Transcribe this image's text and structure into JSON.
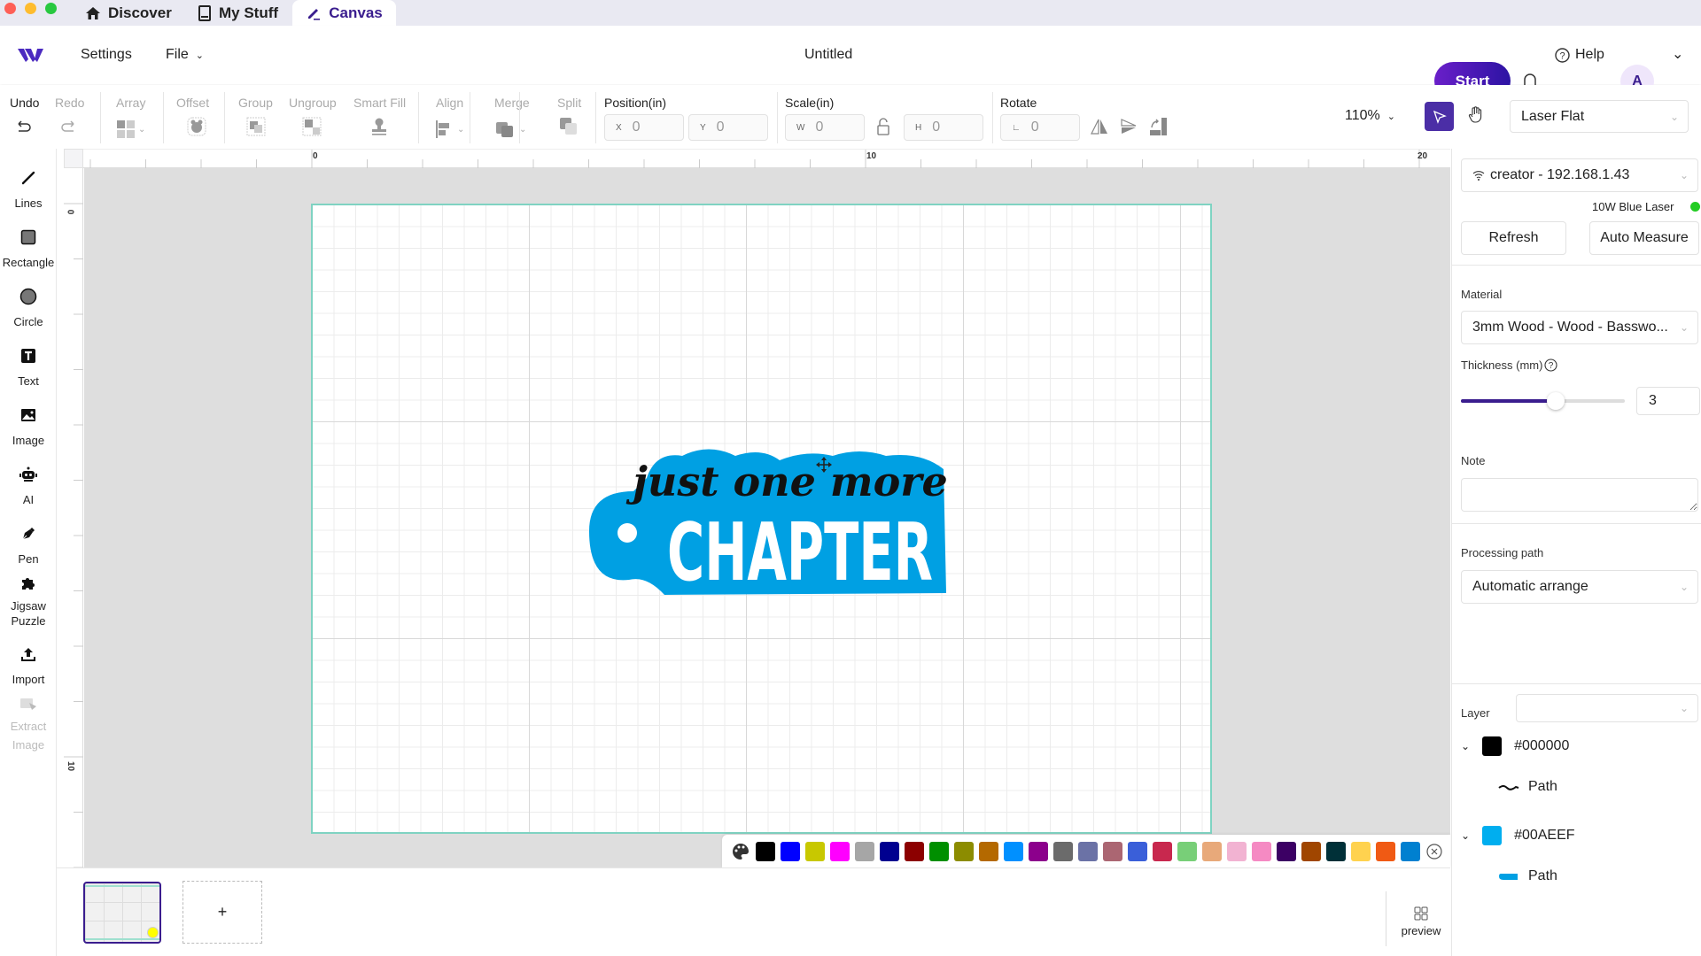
{
  "tabs": [
    {
      "label": "Discover",
      "icon": "home-icon"
    },
    {
      "label": "My Stuff",
      "icon": "tablet-icon"
    },
    {
      "label": "Canvas",
      "icon": "pencil-icon",
      "active": true
    }
  ],
  "header": {
    "settings_label": "Settings",
    "file_label": "File",
    "doc_title": "Untitled",
    "start_label": "Start",
    "help_label": "Help",
    "avatar_initial": "A"
  },
  "toolbar": {
    "undo": "Undo",
    "redo": "Redo",
    "array": "Array",
    "offset": "Offset",
    "group": "Group",
    "ungroup": "Ungroup",
    "smart_fill": "Smart Fill",
    "align": "Align",
    "merge": "Merge",
    "split": "Split",
    "position_label": "Position(in)",
    "x_prefix": "X",
    "x_value": "0",
    "y_prefix": "Y",
    "y_value": "0",
    "scale_label": "Scale(in)",
    "w_prefix": "W",
    "w_value": "0",
    "h_prefix": "H",
    "h_value": "0",
    "rotate_label": "Rotate",
    "rotate_value": "0",
    "zoom": "110%",
    "machine_mode": "Laser Flat"
  },
  "left_tools": [
    {
      "label": "Lines",
      "icon": "line-icon"
    },
    {
      "label": "Rectangle",
      "icon": "rectangle-icon"
    },
    {
      "label": "Circle",
      "icon": "circle-icon"
    },
    {
      "label": "Text",
      "icon": "text-icon"
    },
    {
      "label": "Image",
      "icon": "image-icon"
    },
    {
      "label": "AI",
      "icon": "robot-icon"
    },
    {
      "label": "Pen",
      "icon": "pen-icon"
    },
    {
      "label": "Jigsaw Puzzle",
      "icon": "puzzle-icon"
    },
    {
      "label": "Import",
      "icon": "upload-icon"
    },
    {
      "label": "Extract Image",
      "icon": "extract-icon",
      "disabled": true
    }
  ],
  "rulers": {
    "h_ticks": [
      "0",
      "10",
      "20"
    ],
    "v_ticks": [
      "0",
      "10"
    ]
  },
  "design": {
    "script_text": "just one more",
    "block_text": "CHAPTER",
    "fill": "#00A0E3"
  },
  "palette": [
    "#000000",
    "#0000ff",
    "#c8c800",
    "#ff00ff",
    "#a6a6a6",
    "#000090",
    "#8c0000",
    "#008f00",
    "#8c8c00",
    "#b46900",
    "#0090ff",
    "#8c008c",
    "#6b6b6b",
    "#6b72a6",
    "#ab6672",
    "#3a5fd9",
    "#c8284e",
    "#78cf78",
    "#e8a97a",
    "#f2b3d2",
    "#f58ac3",
    "#3c0064",
    "#a04600",
    "#003038",
    "#ffd24f",
    "#f05a14",
    "#0080d0"
  ],
  "pages": {
    "add_label": "+",
    "preview_label": "preview"
  },
  "right_panel": {
    "device": "creator - 192.168.1.43",
    "laser": "10W Blue Laser",
    "laser_status_color": "#22cc22",
    "refresh": "Refresh",
    "auto_measure": "Auto Measure",
    "material_label": "Material",
    "material_value": "3mm Wood - Wood - Basswo...",
    "thickness_label": "Thickness (mm)",
    "thickness_value": "3",
    "thickness_slider_fraction": 0.58,
    "note_label": "Note",
    "note_value": "",
    "processing_label": "Processing path",
    "processing_value": "Automatic arrange",
    "layer_label": "Layer",
    "layer_value": "",
    "layers": [
      {
        "color": "#000000",
        "label": "#000000",
        "child": "Path"
      },
      {
        "color": "#00AEEF",
        "label": "#00AEEF",
        "child": "Path"
      }
    ]
  }
}
